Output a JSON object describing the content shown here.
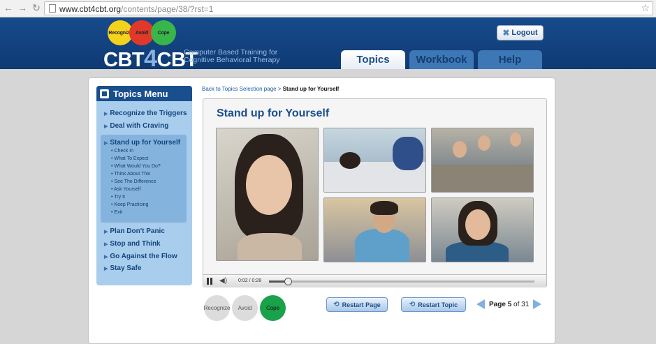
{
  "browser": {
    "url_host": "www.cbt4cbt.org",
    "url_path": "/contents/page/38/?rst=1"
  },
  "header": {
    "logo_circles": [
      "Recognize",
      "Avoid",
      "Cope"
    ],
    "logo_cbt_left": "CBT",
    "logo_four": "4",
    "logo_cbt_right": "CBT",
    "tagline_line1": "Computer Based Training for",
    "tagline_line2": "Cognitive Behavioral Therapy",
    "logout_label": "Logout",
    "tabs": [
      "Topics",
      "Workbook",
      "Help"
    ],
    "active_tab": "Topics"
  },
  "sidebar": {
    "title": "Topics Menu",
    "items": [
      "Recognize the Triggers",
      "Deal with Craving",
      "Stand up for Yourself",
      "Plan Don't Panic",
      "Stop and Think",
      "Go Against the Flow",
      "Stay Safe"
    ],
    "active_item": "Stand up for Yourself",
    "sub_items": [
      "Check In",
      "What To Expect",
      "What Would You Do?",
      "Think About This",
      "See The Difference",
      "Ask Yourself",
      "Try It",
      "Keep Practicing",
      "Exit"
    ]
  },
  "breadcrumb": {
    "link": "Back to Topics Selection page",
    "separator": " > ",
    "current": "Stand up for Yourself"
  },
  "video": {
    "title": "Stand up for Yourself",
    "time": "0:02 / 0:28",
    "progress_fraction": 0.07
  },
  "footer": {
    "circles": [
      "Recognize",
      "Avoid",
      "Cope"
    ],
    "active_circle": "Cope",
    "restart_page_label": "Restart Page",
    "restart_topic_label": "Restart Topic",
    "page_word": "Page",
    "page_number": "5",
    "page_of": "of 31"
  },
  "colors": {
    "header_blue": "#174b8c",
    "recognize": "#f4d31c",
    "avoid": "#e0382b",
    "cope": "#39b54a"
  }
}
